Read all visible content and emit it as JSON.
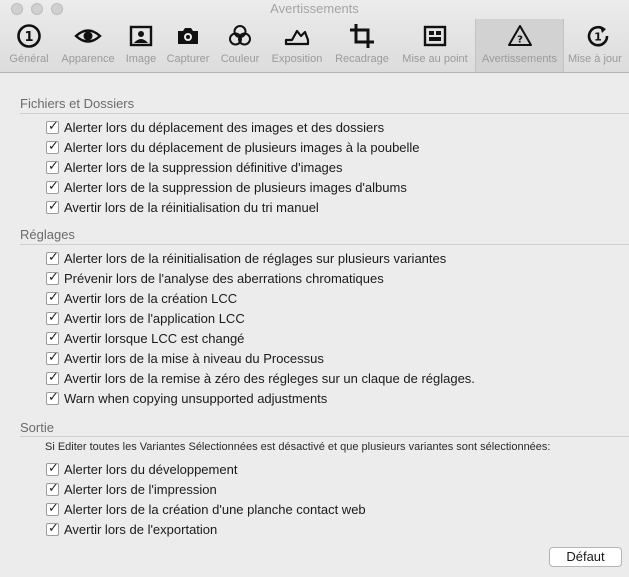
{
  "window": {
    "title": "Avertissements"
  },
  "toolbar": {
    "items": [
      {
        "label": "Général",
        "icon": "general-icon"
      },
      {
        "label": "Apparence",
        "icon": "eye-icon"
      },
      {
        "label": "Image",
        "icon": "image-icon"
      },
      {
        "label": "Capturer",
        "icon": "camera-icon"
      },
      {
        "label": "Couleur",
        "icon": "color-circles-icon"
      },
      {
        "label": "Exposition",
        "icon": "exposure-icon"
      },
      {
        "label": "Recadrage",
        "icon": "crop-icon"
      },
      {
        "label": "Mise au point",
        "icon": "focus-icon"
      },
      {
        "label": "Avertissements",
        "icon": "warning-icon",
        "selected": true
      },
      {
        "label": "Mise à jour",
        "icon": "update-icon"
      }
    ]
  },
  "sections": [
    {
      "title": "Fichiers et Dossiers",
      "items": [
        {
          "label": "Alerter lors du déplacement des images et des dossiers",
          "checked": true
        },
        {
          "label": "Alerter lors du déplacement de plusieurs images à la poubelle",
          "checked": true
        },
        {
          "label": "Alerter lors de la suppression définitive d'images",
          "checked": true
        },
        {
          "label": "Alerter lors de la suppression de plusieurs images d'albums",
          "checked": true
        },
        {
          "label": "Avertir lors de la réinitialisation du tri manuel",
          "checked": true
        }
      ]
    },
    {
      "title": "Réglages",
      "items": [
        {
          "label": "Alerter lors de la réinitialisation de réglages sur plusieurs variantes",
          "checked": true
        },
        {
          "label": "Prévenir lors de l'analyse des aberrations chromatiques",
          "checked": true
        },
        {
          "label": "Avertir lors de la création LCC",
          "checked": true
        },
        {
          "label": "Avertir lors de l'application LCC",
          "checked": true
        },
        {
          "label": "Avertir lorsque LCC est changé",
          "checked": true
        },
        {
          "label": "Avertir lors de la mise à niveau du Processus",
          "checked": true
        },
        {
          "label": "Avertir lors de la remise à zéro des régleges sur un claque de réglages.",
          "checked": true
        },
        {
          "label": "Warn when copying unsupported adjustments",
          "checked": true
        }
      ]
    },
    {
      "title": "Sortie",
      "note": "Si Editer toutes les Variantes Sélectionnées est désactivé et que plusieurs variantes sont sélectionnées:",
      "items": [
        {
          "label": "Alerter lors du développement",
          "checked": true
        },
        {
          "label": "Alerter lors de l'impression",
          "checked": true
        },
        {
          "label": "Alerter lors de la création d'une planche contact web",
          "checked": true
        },
        {
          "label": "Avertir lors de l'exportation",
          "checked": true
        }
      ]
    }
  ],
  "buttons": {
    "default_label": "Défaut"
  },
  "colors": {
    "checkmark": "#222222",
    "selected_tab_bg": "#d2d2d2"
  }
}
